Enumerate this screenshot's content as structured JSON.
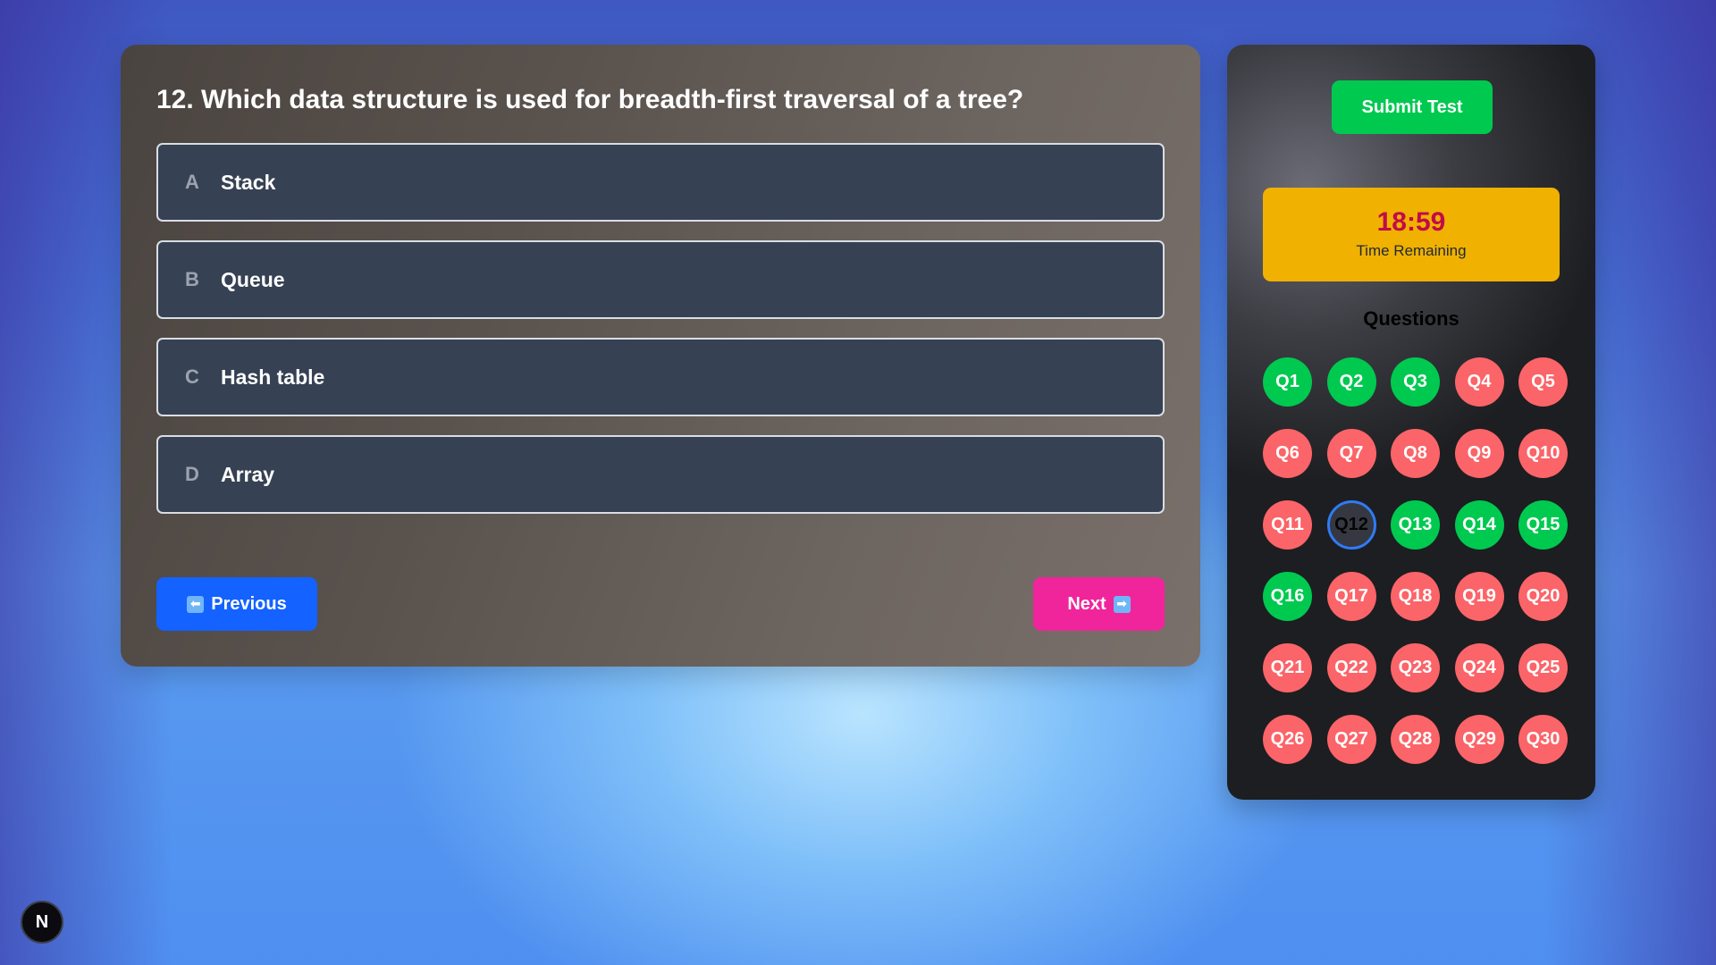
{
  "question": {
    "title": "12. Which data structure is used for breadth-first traversal of a tree?",
    "options": [
      {
        "letter": "A",
        "text": "Stack"
      },
      {
        "letter": "B",
        "text": "Queue"
      },
      {
        "letter": "C",
        "text": "Hash table"
      },
      {
        "letter": "D",
        "text": "Array"
      }
    ]
  },
  "nav": {
    "previous_label": "Previous",
    "previous_icon": "⬅",
    "next_label": "Next",
    "next_icon": "➡"
  },
  "sidebar": {
    "submit_label": "Submit Test",
    "timer_value": "18:59",
    "timer_label": "Time Remaining",
    "questions_heading": "Questions",
    "questions": [
      {
        "label": "Q1",
        "status": "answered"
      },
      {
        "label": "Q2",
        "status": "answered"
      },
      {
        "label": "Q3",
        "status": "answered"
      },
      {
        "label": "Q4",
        "status": "unanswered"
      },
      {
        "label": "Q5",
        "status": "unanswered"
      },
      {
        "label": "Q6",
        "status": "unanswered"
      },
      {
        "label": "Q7",
        "status": "unanswered"
      },
      {
        "label": "Q8",
        "status": "unanswered"
      },
      {
        "label": "Q9",
        "status": "unanswered"
      },
      {
        "label": "Q10",
        "status": "unanswered"
      },
      {
        "label": "Q11",
        "status": "unanswered"
      },
      {
        "label": "Q12",
        "status": "current"
      },
      {
        "label": "Q13",
        "status": "answered"
      },
      {
        "label": "Q14",
        "status": "answered"
      },
      {
        "label": "Q15",
        "status": "answered"
      },
      {
        "label": "Q16",
        "status": "answered"
      },
      {
        "label": "Q17",
        "status": "unanswered"
      },
      {
        "label": "Q18",
        "status": "unanswered"
      },
      {
        "label": "Q19",
        "status": "unanswered"
      },
      {
        "label": "Q20",
        "status": "unanswered"
      },
      {
        "label": "Q21",
        "status": "unanswered"
      },
      {
        "label": "Q22",
        "status": "unanswered"
      },
      {
        "label": "Q23",
        "status": "unanswered"
      },
      {
        "label": "Q24",
        "status": "unanswered"
      },
      {
        "label": "Q25",
        "status": "unanswered"
      },
      {
        "label": "Q26",
        "status": "unanswered"
      },
      {
        "label": "Q27",
        "status": "unanswered"
      },
      {
        "label": "Q28",
        "status": "unanswered"
      },
      {
        "label": "Q29",
        "status": "unanswered"
      },
      {
        "label": "Q30",
        "status": "unanswered"
      }
    ]
  },
  "badge": {
    "text": "N"
  },
  "colors": {
    "answered": "#00c950",
    "unanswered": "#fb6468",
    "current_ring": "#2f7bf5",
    "submit": "#00c950",
    "previous": "#1462ff",
    "next": "#f0259b",
    "timer_bg": "#f0b100",
    "timer_text": "#c10b4a"
  }
}
